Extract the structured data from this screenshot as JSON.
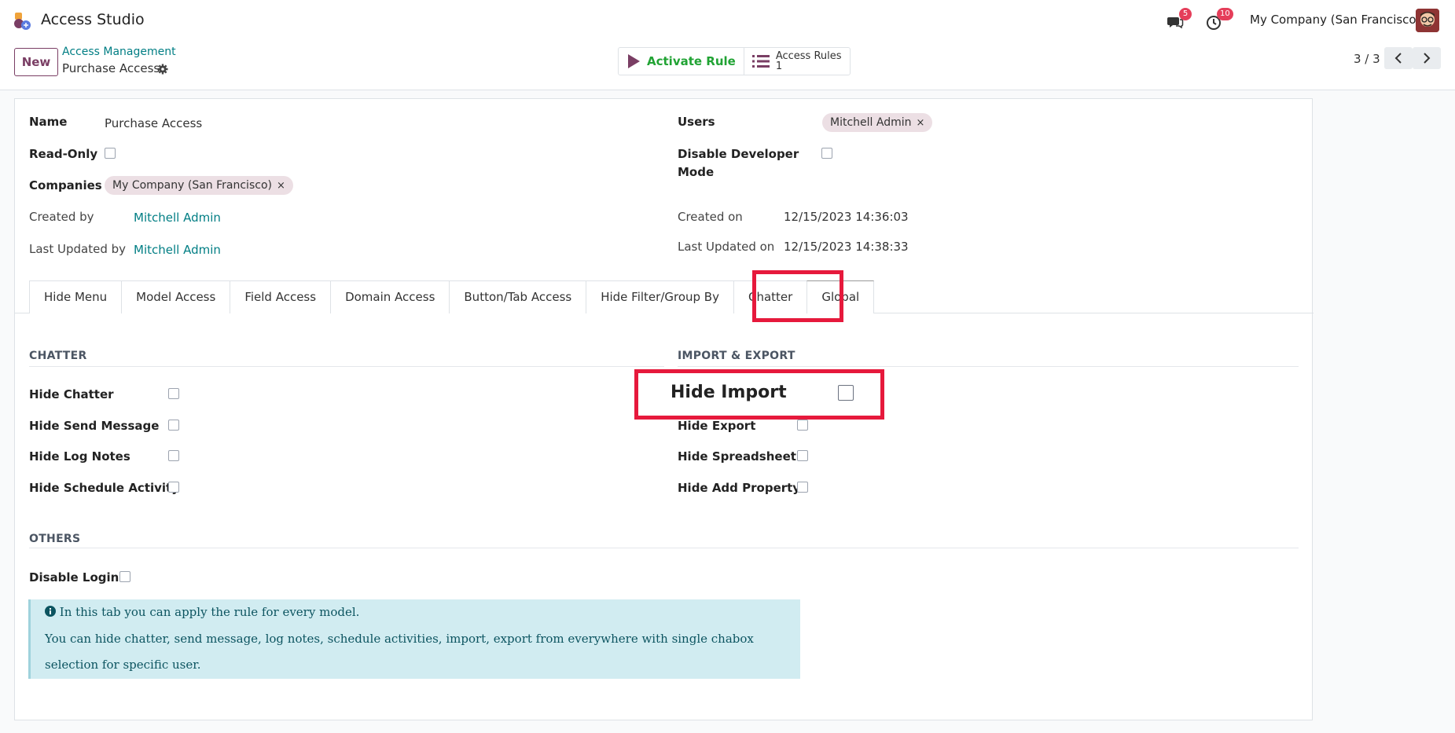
{
  "app": {
    "title": "Access Studio"
  },
  "topbar": {
    "messages_count": "5",
    "activities_count": "10",
    "company": "My Company (San Francisco)",
    "icons": [
      "chat-icon",
      "clock-icon",
      "avatar"
    ]
  },
  "control": {
    "new_label": "New",
    "breadcrumb_parent": "Access Management",
    "breadcrumb_current": "Purchase Access",
    "activate_label": "Activate Rule",
    "access_rules_label": "Access Rules",
    "access_rules_count": "1",
    "pager": "3 / 3"
  },
  "form": {
    "name_label": "Name",
    "name_value": "Purchase Access",
    "readonly_label": "Read-Only",
    "companies_label": "Companies",
    "companies_tag": "My Company (San Francisco)",
    "created_by_label": "Created by",
    "created_by_value": "Mitchell Admin",
    "last_updated_by_label": "Last Updated by",
    "last_updated_by_value": "Mitchell Admin",
    "users_label": "Users",
    "users_tag": "Mitchell Admin",
    "disable_dev_label_1": "Disable Developer",
    "disable_dev_label_2": "Mode",
    "created_on_label": "Created on",
    "created_on_value": "12/15/2023 14:36:03",
    "last_updated_on_label": "Last Updated on",
    "last_updated_on_value": "12/15/2023 14:38:33"
  },
  "tabs": [
    "Hide Menu",
    "Model Access",
    "Field Access",
    "Domain Access",
    "Button/Tab Access",
    "Hide Filter/Group By",
    "Chatter",
    "Global"
  ],
  "active_tab": "Global",
  "global": {
    "chatter_title": "CHATTER",
    "chatter_items": [
      "Hide Chatter",
      "Hide Send Message",
      "Hide Log Notes",
      "Hide Schedule Activity"
    ],
    "import_export_title": "IMPORT & EXPORT",
    "import_export_items": [
      "Hide Import",
      "Hide Export",
      "Hide Spreadsheet",
      "Hide Add Property"
    ],
    "others_title": "OTHERS",
    "disable_login_label": "Disable Login",
    "info_line_1": "In this tab you can apply the rule for every model.",
    "info_line_2": "You can hide chatter, send message, log notes, schedule activities, import, export from everywhere with single chabox",
    "info_line_3": "selection for specific user."
  },
  "highlight": {
    "color": "#e6193c"
  }
}
